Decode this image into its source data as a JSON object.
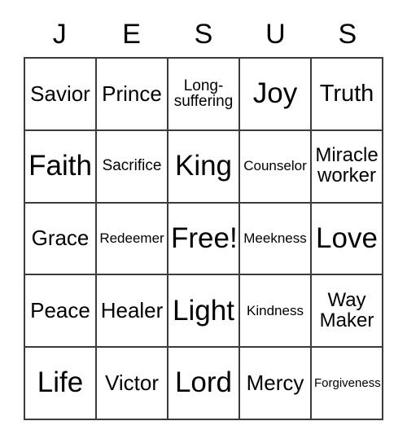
{
  "card": {
    "header_letters": [
      "J",
      "E",
      "S",
      "U",
      "S"
    ],
    "background_color": "#ffffff",
    "border_color": "#3b3b3b",
    "text_color": "#000000",
    "rows": [
      [
        {
          "label": "Savior",
          "size": "md"
        },
        {
          "label": "Prince",
          "size": "md"
        },
        {
          "label": "Long-suffering",
          "size": "xs"
        },
        {
          "label": "Joy",
          "size": "xl"
        },
        {
          "label": "Truth",
          "size": "lg"
        }
      ],
      [
        {
          "label": "Faith",
          "size": "xl"
        },
        {
          "label": "Sacrifice",
          "size": "xs"
        },
        {
          "label": "King",
          "size": "xl"
        },
        {
          "label": "Counselor",
          "size": "xxs"
        },
        {
          "label": "Miracle worker",
          "size": "sm"
        }
      ],
      [
        {
          "label": "Grace",
          "size": "md"
        },
        {
          "label": "Redeemer",
          "size": "xxs"
        },
        {
          "label": "Free!",
          "size": "xl"
        },
        {
          "label": "Meekness",
          "size": "xxs"
        },
        {
          "label": "Love",
          "size": "xl"
        }
      ],
      [
        {
          "label": "Peace",
          "size": "md"
        },
        {
          "label": "Healer",
          "size": "md"
        },
        {
          "label": "Light",
          "size": "xl"
        },
        {
          "label": "Kindness",
          "size": "xxs"
        },
        {
          "label": "Way Maker",
          "size": "sm"
        }
      ],
      [
        {
          "label": "Life",
          "size": "xl"
        },
        {
          "label": "Victor",
          "size": "md"
        },
        {
          "label": "Lord",
          "size": "xl"
        },
        {
          "label": "Mercy",
          "size": "md"
        },
        {
          "label": "Forgiveness",
          "size": "min"
        }
      ]
    ]
  }
}
